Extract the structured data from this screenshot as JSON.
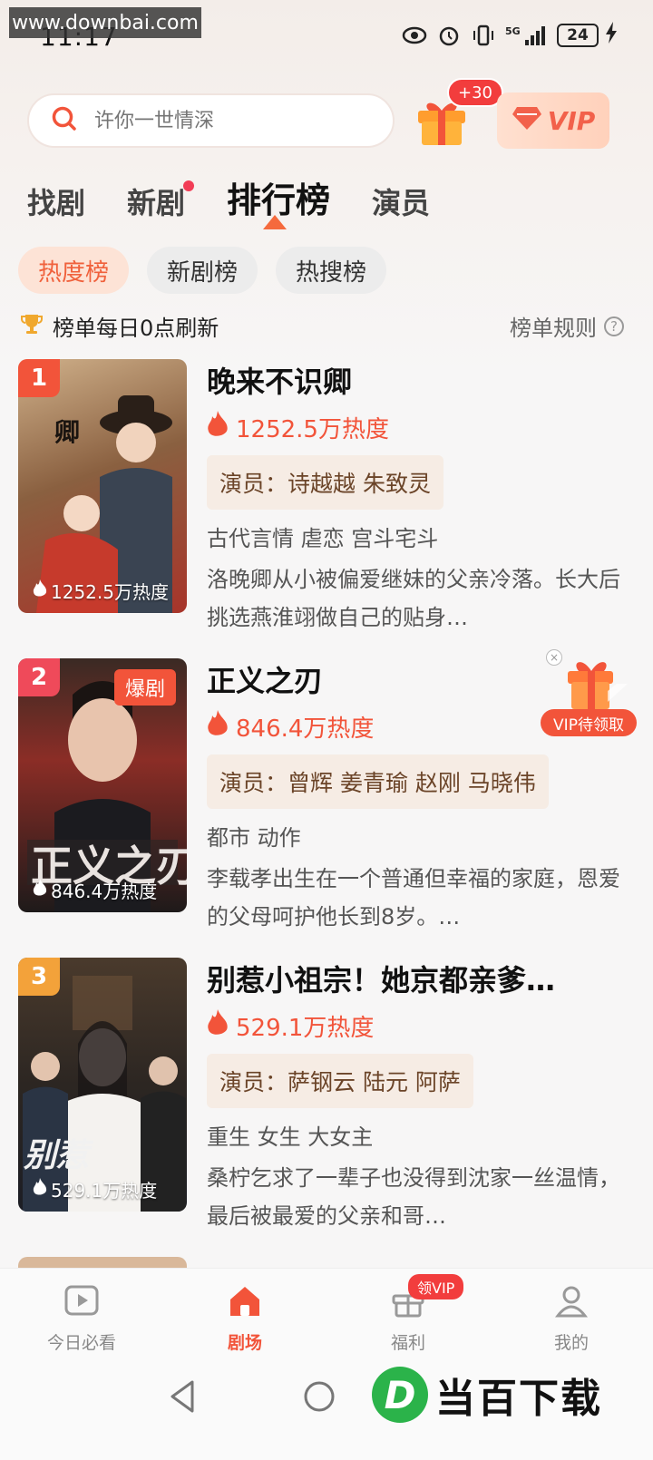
{
  "watermark_top": "www.downbai.com",
  "status_bar": {
    "time": "11:17",
    "battery": "24",
    "network": "5G"
  },
  "search": {
    "placeholder": "许你一世情深"
  },
  "gift_badge": "+30",
  "vip_button": "VIP",
  "tabs": [
    {
      "label": "找剧"
    },
    {
      "label": "新剧"
    },
    {
      "label": "排行榜"
    },
    {
      "label": "演员"
    }
  ],
  "chips": [
    {
      "label": "热度榜"
    },
    {
      "label": "新剧榜"
    },
    {
      "label": "热搜榜"
    }
  ],
  "refresh_text": "榜单每日0点刷新",
  "rules_text": "榜单规则",
  "items": [
    {
      "rank": "1",
      "title": "晚来不识卿",
      "heat": "1252.5万热度",
      "poster_heat": "1252.5万热度",
      "cast": "演员：诗越越 朱致灵",
      "genre": "古代言情 虐恋 宫斗宅斗",
      "desc": "洛晚卿从小被偏爱继妹的父亲冷落。长大后挑选燕淮翊做自己的贴身…",
      "poster_text": "晚来不识卿",
      "colors": [
        "#6b4a30",
        "#c79b6b",
        "#a33a2a"
      ]
    },
    {
      "rank": "2",
      "title": "正义之刃",
      "heat": "846.4万热度",
      "poster_heat": "846.4万热度",
      "poster_tag": "爆剧",
      "cast": "演员：曾辉 姜青瑜 赵刚 马晓伟",
      "genre": "都市 动作",
      "desc": "李载孝出生在一个普通但幸福的家庭，恩爱的父母呵护他长到8岁。…",
      "poster_text": "正义之刃",
      "colors": [
        "#2a1f1c",
        "#8a2a24",
        "#3b3b3b"
      ]
    },
    {
      "rank": "3",
      "title": "别惹小祖宗！她京都亲爹…",
      "heat": "529.1万热度",
      "poster_heat": "529.1万热度",
      "cast": "演员：萨钢云 陆元 阿萨",
      "genre": "重生 女生 大女主",
      "desc": "桑柠乞求了一辈子也没得到沈家一丝温情，最后被最爱的父亲和哥…",
      "poster_text": "别惹小祖宗",
      "colors": [
        "#3a2c24",
        "#d8d2cb",
        "#1f2630"
      ]
    }
  ],
  "vip_float_label": "VIP待领取",
  "bottom_nav": [
    {
      "label": "今日必看",
      "icon": "play-icon"
    },
    {
      "label": "剧场",
      "icon": "home-icon"
    },
    {
      "label": "福利",
      "icon": "gift-icon",
      "badge": "领VIP"
    },
    {
      "label": "我的",
      "icon": "user-icon"
    }
  ],
  "watermark_bottom": "当百下载",
  "colors": {
    "accent": "#f2543a",
    "rank1": "#f2543a",
    "rank2": "#ef4a5a",
    "rank3": "#f3a23a"
  }
}
